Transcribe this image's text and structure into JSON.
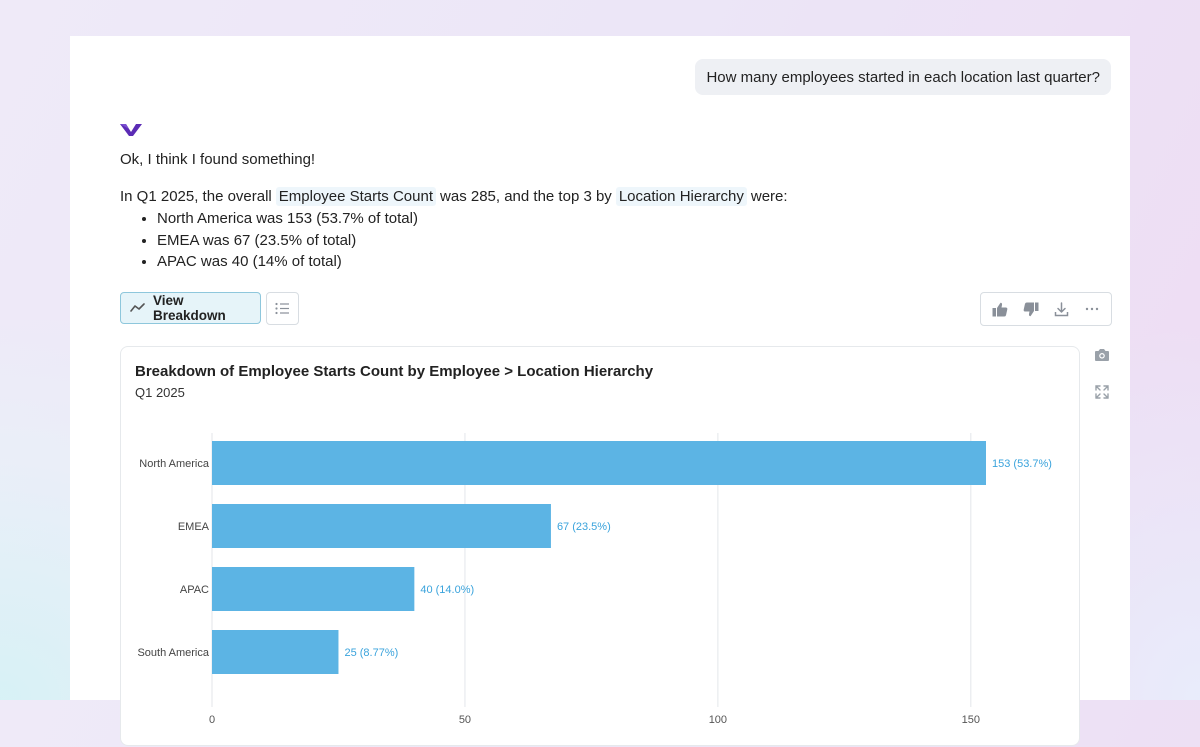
{
  "conversation": {
    "user_question": "How many employees started in each location last quarter?",
    "reply_intro": "Ok, I think I found something!",
    "summary": {
      "prefix": "In Q1 2025, the overall",
      "metric_chip": "Employee Starts Count",
      "middle": "was 285, and the top 3 by",
      "dimension_chip": "Location Hierarchy",
      "suffix": "were:"
    },
    "bullets": [
      "North America was 153 (53.7% of total)",
      "EMEA was 67 (23.5% of total)",
      "APAC was 40 (14% of total)"
    ]
  },
  "toolbar": {
    "view_breakdown_label": "View Breakdown",
    "icons": [
      "trend-icon",
      "list-icon",
      "thumbs-up-icon",
      "thumbs-down-icon",
      "download-icon",
      "more-icon",
      "camera-icon",
      "expand-icon"
    ]
  },
  "colors": {
    "bar": "#5cb4e4",
    "bar_label": "#3aa3dc",
    "chip_bg": "#eef6fb",
    "button_accent": "#e6f4f9",
    "logo": "#5b2bb5"
  },
  "chart_data": {
    "type": "bar",
    "orientation": "horizontal",
    "title": "Breakdown of Employee Starts Count by Employee > Location Hierarchy",
    "subtitle": "Q1 2025",
    "categories": [
      "North America",
      "EMEA",
      "APAC",
      "South America"
    ],
    "values": [
      153,
      67,
      40,
      25
    ],
    "value_labels": [
      "153 (53.7%)",
      "67 (23.5%)",
      "40 (14.0%)",
      "25 (8.77%)"
    ],
    "xticks": [
      0,
      50,
      100,
      150
    ],
    "xlim": [
      0,
      153
    ],
    "grid": true
  }
}
